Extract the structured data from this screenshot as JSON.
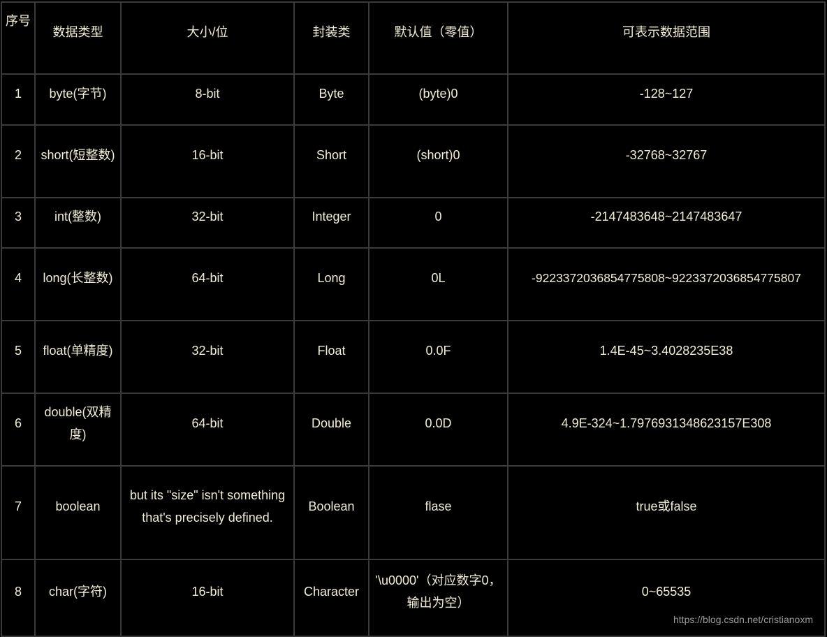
{
  "table": {
    "headers": [
      "序号",
      "数据类型",
      "大小/位",
      "封装类",
      "默认值（零值）",
      "可表示数据范围"
    ],
    "rows": [
      {
        "seq": "1",
        "type": "byte(字节)",
        "size": "8-bit",
        "wrapper": "Byte",
        "default": "(byte)0",
        "range": "-128~127"
      },
      {
        "seq": "2",
        "type": "short(短整数)",
        "size": "16-bit",
        "wrapper": "Short",
        "default": "(short)0",
        "range": "-32768~32767"
      },
      {
        "seq": "3",
        "type": "int(整数)",
        "size": "32-bit",
        "wrapper": "Integer",
        "default": "0",
        "range": "-2147483648~2147483647"
      },
      {
        "seq": "4",
        "type": "long(长整数)",
        "size": "64-bit",
        "wrapper": "Long",
        "default": "0L",
        "range": "-9223372036854775808~9223372036854775807"
      },
      {
        "seq": "5",
        "type": "float(单精度)",
        "size": "32-bit",
        "wrapper": "Float",
        "default": "0.0F",
        "range": "1.4E-45~3.4028235E38"
      },
      {
        "seq": "6",
        "type": "double(双精度)",
        "size": "64-bit",
        "wrapper": "Double",
        "default": "0.0D",
        "range": "4.9E-324~1.7976931348623157E308"
      },
      {
        "seq": "7",
        "type": "boolean",
        "size": "but its \"size\" isn't something that's precisely defined.",
        "wrapper": "Boolean",
        "default": "flase",
        "range": "true或false"
      },
      {
        "seq": "8",
        "type": "char(字符)",
        "size": "16-bit",
        "wrapper": "Character",
        "default": "'\\u0000'（对应数字0，输出为空）",
        "range": "0~65535"
      }
    ]
  },
  "watermark": "https://blog.csdn.net/cristianoxm",
  "colors": {
    "background": "#000000",
    "text": "#f2ecd6",
    "border": "#3a3a3a"
  }
}
